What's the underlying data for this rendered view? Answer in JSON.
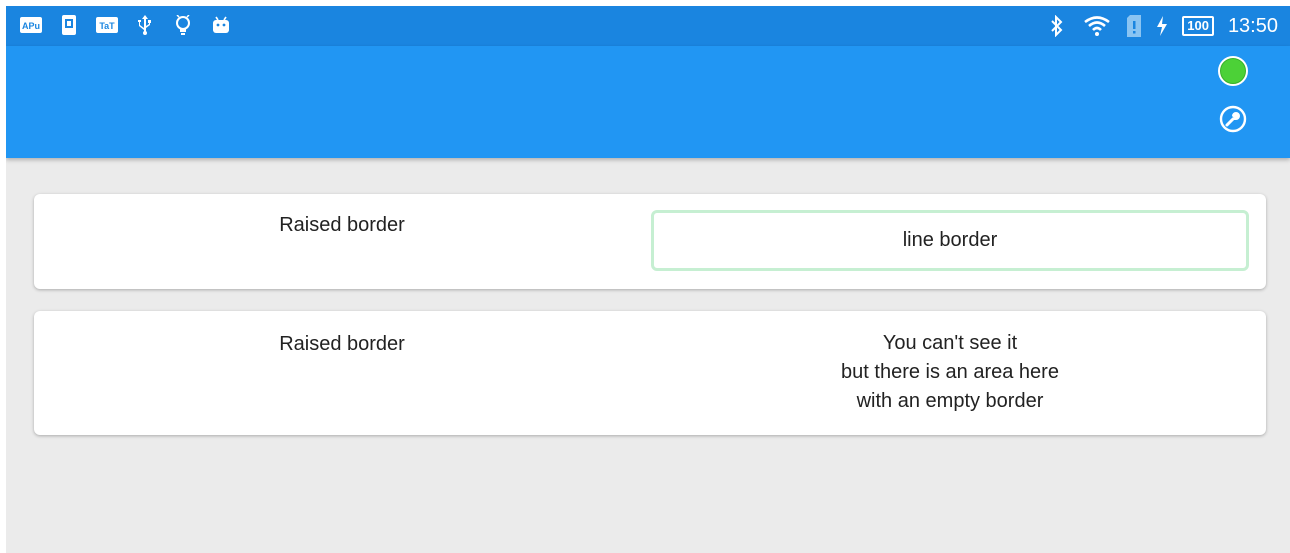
{
  "status_bar": {
    "left_icons": [
      "apu-icon",
      "app-icon",
      "tt-icon",
      "usb-icon",
      "bulb-icon",
      "android-icon"
    ],
    "apu_label": "APu",
    "tt_label": "TaT",
    "battery_level": "100",
    "time": "13:50"
  },
  "app_bar": {
    "background_color": "#2196f3",
    "status_indicator_color": "#4cd137"
  },
  "cards": [
    {
      "left_label": "Raised border",
      "right_label": "line border",
      "right_border_color": "#c6efd2"
    },
    {
      "left_label": "Raised border",
      "right_lines": [
        "You can't see it",
        "but there is an area here",
        "with an empty border"
      ]
    }
  ]
}
